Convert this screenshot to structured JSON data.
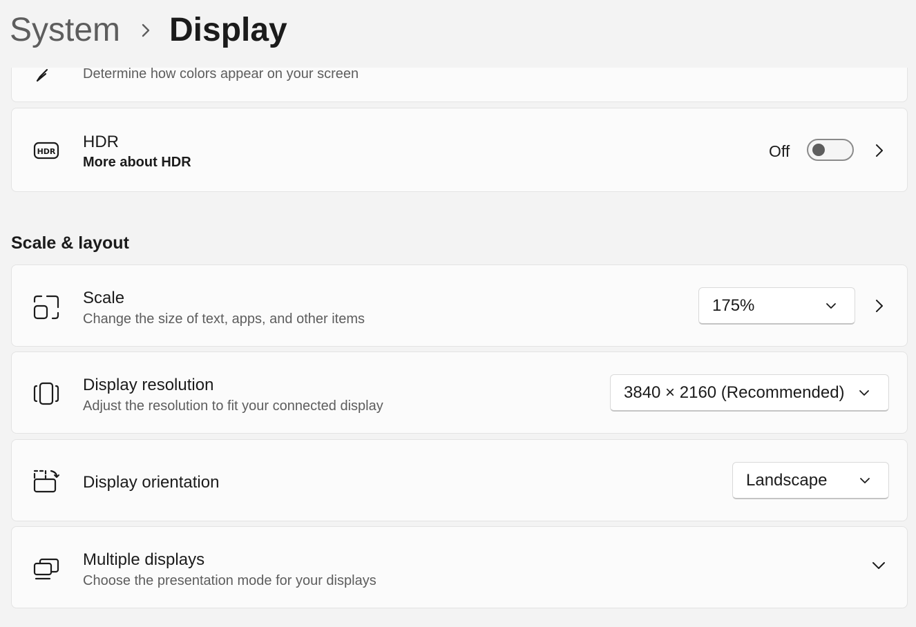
{
  "header": {
    "breadcrumb_parent": "System",
    "breadcrumb_current": "Display"
  },
  "color_profile": {
    "description": "Determine how colors appear on your screen",
    "icon": "pen-icon"
  },
  "hdr": {
    "title": "HDR",
    "link": "More about HDR",
    "toggle_label": "Off",
    "toggle_state": false,
    "icon": "hdr-icon"
  },
  "scale_layout": {
    "heading": "Scale & layout",
    "scale": {
      "title": "Scale",
      "description": "Change the size of text, apps, and other items",
      "value": "175%",
      "icon": "scale-icon"
    },
    "resolution": {
      "title": "Display resolution",
      "description": "Adjust the resolution to fit your connected display",
      "value": "3840 × 2160 (Recommended)",
      "icon": "resolution-icon"
    },
    "orientation": {
      "title": "Display orientation",
      "value": "Landscape",
      "icon": "orientation-icon"
    },
    "multiple_displays": {
      "title": "Multiple displays",
      "description": "Choose the presentation mode for your displays",
      "icon": "multiple-displays-icon"
    }
  },
  "colors": {
    "background": "#f3f3f3",
    "card": "#fbfbfb",
    "text_primary": "#1b1b1b",
    "text_secondary": "#5d5d5d"
  }
}
